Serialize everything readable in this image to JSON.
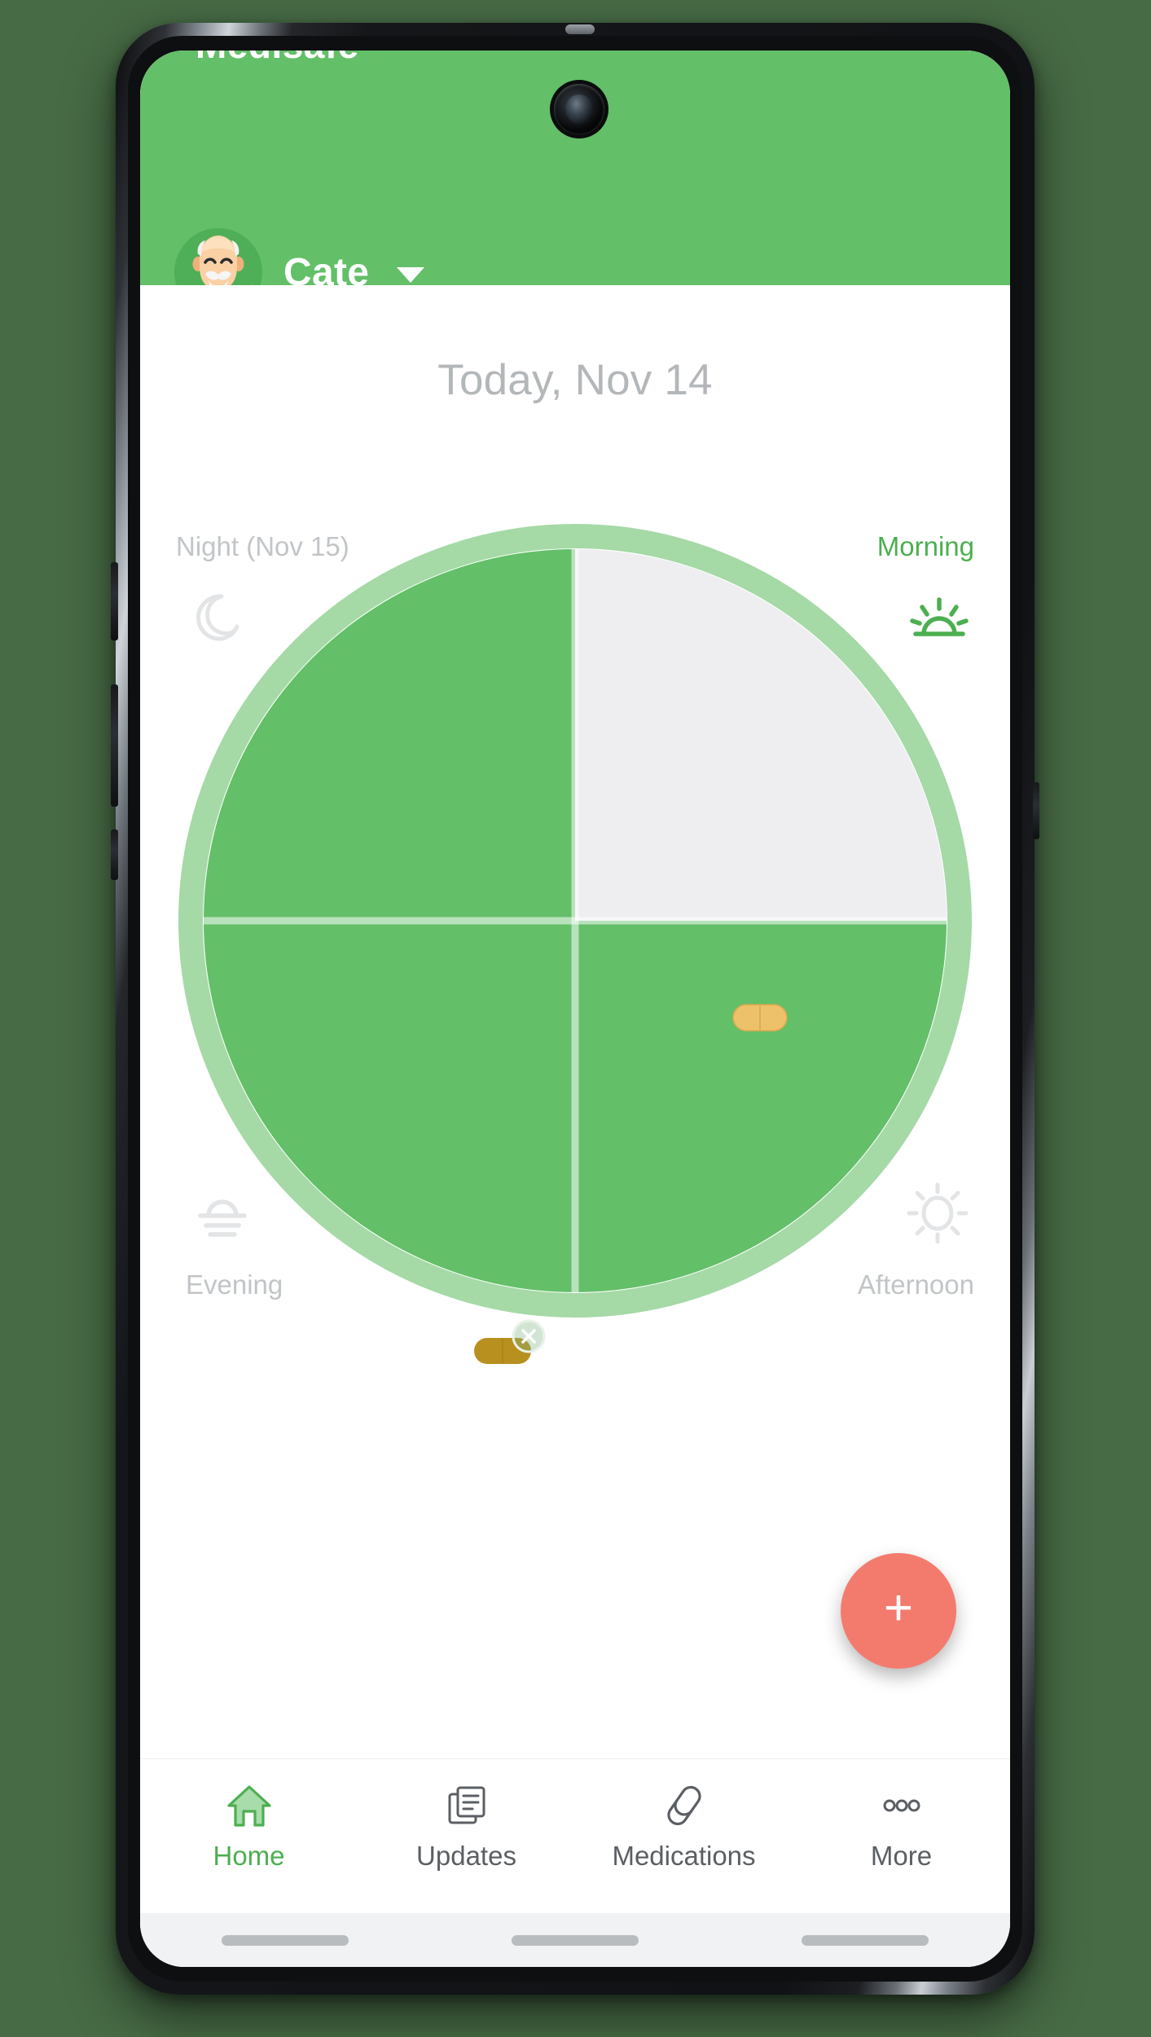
{
  "app": {
    "title": "Medisafe",
    "header_color": "#63bf68",
    "accent_green": "#4caf50",
    "fab_color": "#f37b6d"
  },
  "header": {
    "profile_name": "Cate",
    "avatar_icon": "elderly-man-avatar",
    "sparkle_icon": "sparkle-badge-icon",
    "caret_icon": "chevron-down-icon"
  },
  "content": {
    "date_label": "Today, Nov 14"
  },
  "wheel": {
    "quadrants": [
      {
        "key": "morning",
        "label": "Morning",
        "icon": "sunrise-icon",
        "state": "pending",
        "label_color": "#4caf50",
        "fill": "#eeeef1"
      },
      {
        "key": "afternoon",
        "label": "Afternoon",
        "icon": "sun-icon",
        "state": "done",
        "label_color": "#c2c5c7",
        "fill": "#63bf68"
      },
      {
        "key": "evening",
        "label": "Evening",
        "icon": "sunset-icon",
        "state": "done",
        "label_color": "#c2c5c7",
        "fill": "#63bf68"
      },
      {
        "key": "night",
        "label": "Night (Nov 15)",
        "icon": "moon-icon",
        "state": "done",
        "label_color": "#c2c5c7",
        "fill": "#63bf68"
      }
    ],
    "ring_color": "#a5d9a6",
    "pills": [
      {
        "id": "pill-morning",
        "quadrant": "morning",
        "state": "pending",
        "color": "#edc06a",
        "badge": null
      },
      {
        "id": "pill-evening",
        "quadrant": "evening",
        "state": "skipped",
        "color": "#b8901f",
        "badge": "close-icon"
      }
    ]
  },
  "fab": {
    "label": "+",
    "icon": "plus-icon"
  },
  "bottom_nav": {
    "items": [
      {
        "label": "Home",
        "icon": "home-icon",
        "active": true
      },
      {
        "label": "Updates",
        "icon": "document-icon",
        "active": false
      },
      {
        "label": "Medications",
        "icon": "capsule-icon",
        "active": false
      },
      {
        "label": "More",
        "icon": "more-dots-icon",
        "active": false
      }
    ]
  }
}
